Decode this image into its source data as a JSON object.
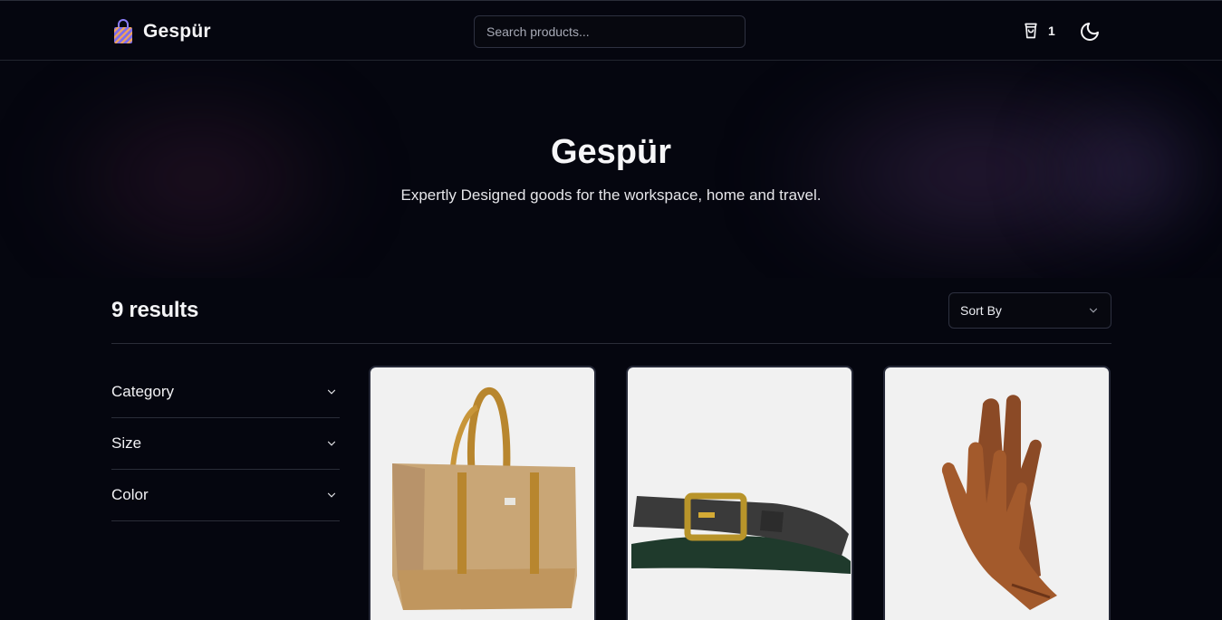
{
  "header": {
    "brand": "Gespür",
    "search_placeholder": "Search products...",
    "cart_count": "1",
    "icons": {
      "logo": "shopping-bag-logo-icon",
      "cart": "shopping-bag-icon",
      "theme": "moon-icon"
    }
  },
  "hero": {
    "title": "Gespür",
    "subtitle": "Expertly Designed goods for the workspace, home and travel."
  },
  "results": {
    "count_label": "9 results"
  },
  "sort": {
    "label": "Sort By"
  },
  "filters": [
    {
      "label": "Category"
    },
    {
      "label": "Size"
    },
    {
      "label": "Color"
    }
  ],
  "products": [
    {
      "image": "canvas-tote-bag"
    },
    {
      "image": "leather-belt"
    },
    {
      "image": "leather-gloves"
    }
  ],
  "colors": {
    "background": "#05060f",
    "border": "#2a2d38",
    "card": "#f1f1f1"
  }
}
